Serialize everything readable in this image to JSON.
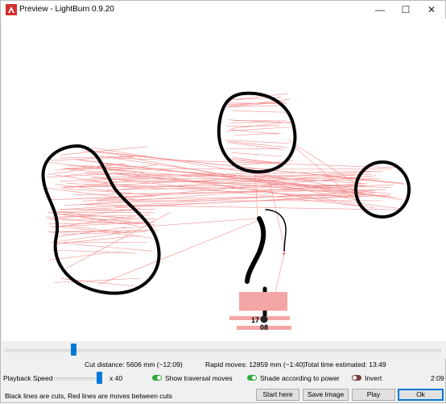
{
  "window": {
    "title": "Preview - LightBurn 0.9.20",
    "minimize_glyph": "—",
    "maximize_glyph": "☐",
    "close_glyph": "✕"
  },
  "preview": {
    "label_a": "17",
    "label_b": "08"
  },
  "stats": {
    "cut_distance": "Cut distance: 5606 mm (~12:09)",
    "rapid_moves": "Rapid moves: 12859 mm (~1:40)",
    "total_time": "Total time estimated: 13:49"
  },
  "controls": {
    "playback_speed_label": "Playback Speed",
    "speed_value": "x 40",
    "show_traversal_label": "Show traversal moves",
    "show_traversal_on": true,
    "shade_power_label": "Shade according to power",
    "shade_power_on": true,
    "invert_label": "Invert",
    "invert_on": false,
    "elapsed_time": "2:09"
  },
  "footer": {
    "legend": "Black lines are cuts, Red lines are moves between cuts",
    "start_here": "Start here",
    "save_image": "Save Image",
    "play": "Play",
    "ok": "Ok"
  },
  "colors": {
    "cut": "#000000",
    "traversal": "#f08080",
    "accent": "#0078d7"
  }
}
